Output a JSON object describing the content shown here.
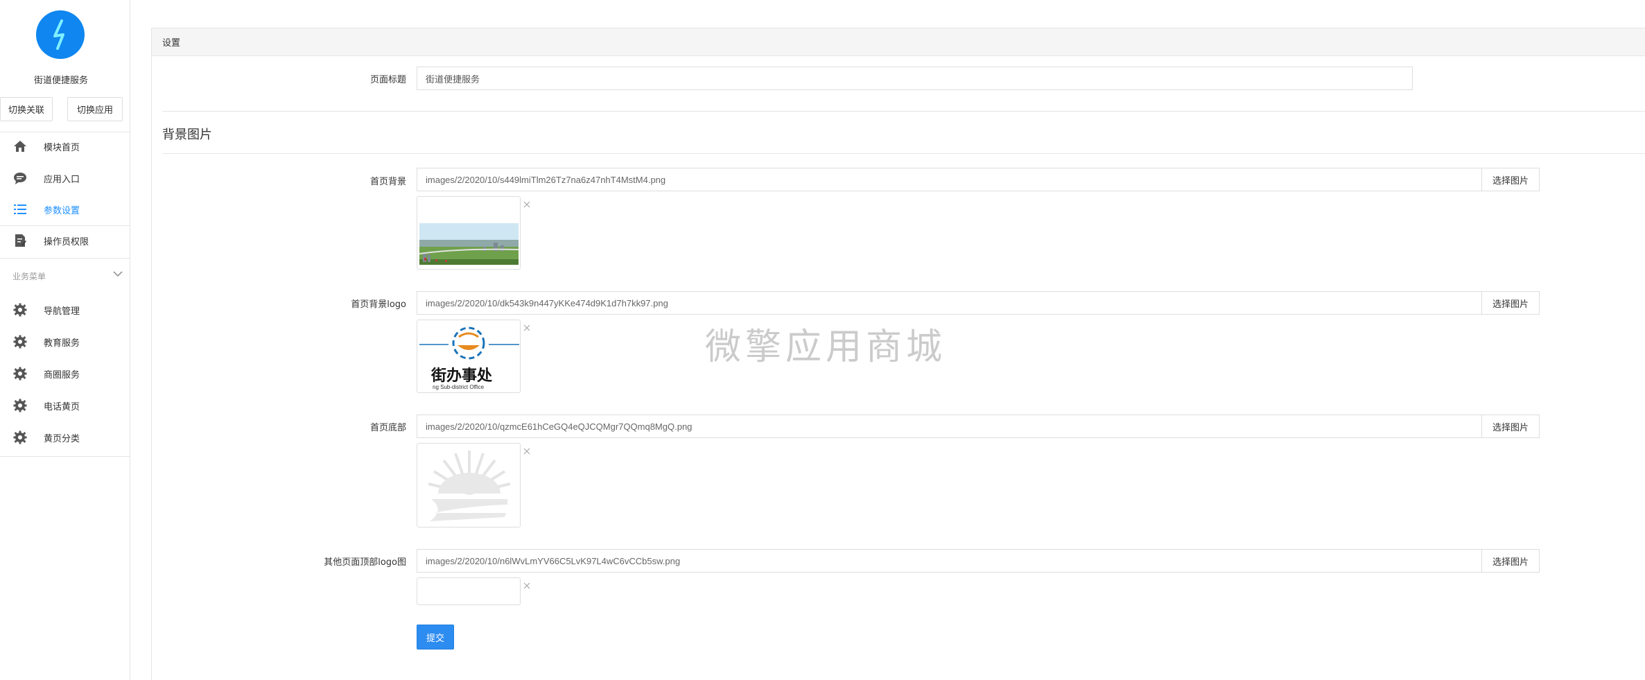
{
  "sidebar": {
    "app_name": "街道便捷服务",
    "switch_related": "切换关联",
    "switch_app": "切换应用",
    "items": [
      {
        "label": "模块首页",
        "icon": "home-icon"
      },
      {
        "label": "应用入口",
        "icon": "chat-icon"
      },
      {
        "label": "参数设置",
        "icon": "list-icon",
        "active": true
      },
      {
        "label": "操作员权限",
        "icon": "edit-doc-icon"
      }
    ],
    "group_label": "业务菜单",
    "group_items": [
      {
        "label": "导航管理",
        "icon": "gear-icon"
      },
      {
        "label": "教育服务",
        "icon": "gear-icon"
      },
      {
        "label": "商圈服务",
        "icon": "gear-icon"
      },
      {
        "label": "电话黄页",
        "icon": "gear-icon"
      },
      {
        "label": "黄页分类",
        "icon": "gear-icon"
      }
    ]
  },
  "panel": {
    "header": "设置",
    "page_title_label": "页面标题",
    "page_title_value": "街道便捷服务",
    "section_title": "背景图片",
    "pick_label": "选择图片",
    "fields": [
      {
        "label": "首页背景",
        "value": "images/2/2020/10/s449lmiTlm26Tz7na6z47nhT4MstM4.png"
      },
      {
        "label": "首页背景logo",
        "value": "images/2/2020/10/dk543k9n447yKKe474d9K1d7h7kk97.png"
      },
      {
        "label": "首页底部",
        "value": "images/2/2020/10/qzmcE61hCeGQ4eQJCQMgr7QQmq8MgQ.png"
      },
      {
        "label": "其他页面顶部logo图",
        "value": "images/2/2020/10/n6lWvLmYV66C5LvK97L4wC6vCCb5sw.png"
      }
    ],
    "logo_text": "街办事处",
    "logo_subtext": "ng Sub-district Office",
    "submit_label": "提交"
  },
  "watermark": "微擎应用商城",
  "colors": {
    "accent": "#2d8cf0",
    "active_text": "#1e90ff",
    "logo_bg": "#0f86f0"
  }
}
